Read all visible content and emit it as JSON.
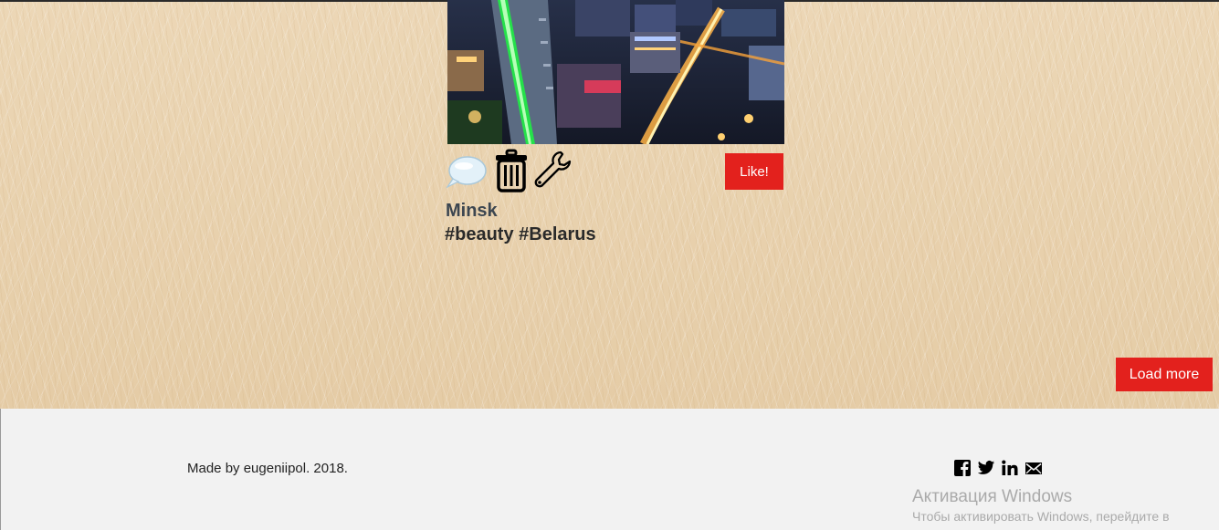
{
  "post": {
    "image_alt": "Minsk night city view",
    "title": "Minsk",
    "tags": "#beauty #Belarus",
    "like_label": "Like!",
    "icons": [
      "speech-bubble-icon",
      "trash-icon",
      "wrench-icon"
    ]
  },
  "feed": {
    "load_more_label": "Load more"
  },
  "footer": {
    "credits": "Made by eugeniipol. 2018.",
    "social": [
      "facebook-icon",
      "twitter-icon",
      "linkedin-icon",
      "mail-icon"
    ]
  },
  "windows_watermark": {
    "title": "Активация Windows",
    "subtitle": "Чтобы активировать Windows, перейдите в"
  },
  "colors": {
    "accent": "#e3211d",
    "background": "#e9d3b1",
    "footer": "#f2f2f2"
  }
}
